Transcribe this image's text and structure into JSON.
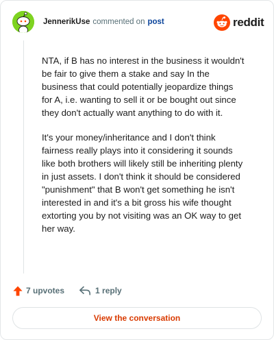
{
  "comment": {
    "author": "JennerikUse",
    "action": "commented on",
    "post_link": "post",
    "paragraphs": [
      "NTA, if B has no interest in the business it wouldn't be fair to give them a stake and say In the business that could potentially jeopardize things for A, i.e. wanting to sell it or be bought out since they don't actually want anything to do with it.",
      "It's your money/inheritance and I don't think fairness really plays into it considering it sounds like both brothers will likely still be inheriting plenty in just assets. I don't think it should be considered \"punishment\" that B won't get something he isn't interested in and it's a bit gross his wife thought extorting you by not visiting was an OK way to get her way."
    ]
  },
  "brand": {
    "wordmark": "reddit",
    "icon": "reddit-snoo-icon",
    "color": "#ff4500"
  },
  "actions": {
    "upvotes_label": "7 upvotes",
    "upvote_icon": "upvote-arrow-icon",
    "replies_label": "1 reply",
    "reply_icon": "reply-arrow-icon"
  },
  "footer": {
    "button_label": "View the conversation"
  },
  "colors": {
    "accent": "#d93a00",
    "upvote": "#ff4500",
    "link": "#0a449b",
    "avatar_bg": "#7ed321",
    "muted_text": "#576f76"
  }
}
